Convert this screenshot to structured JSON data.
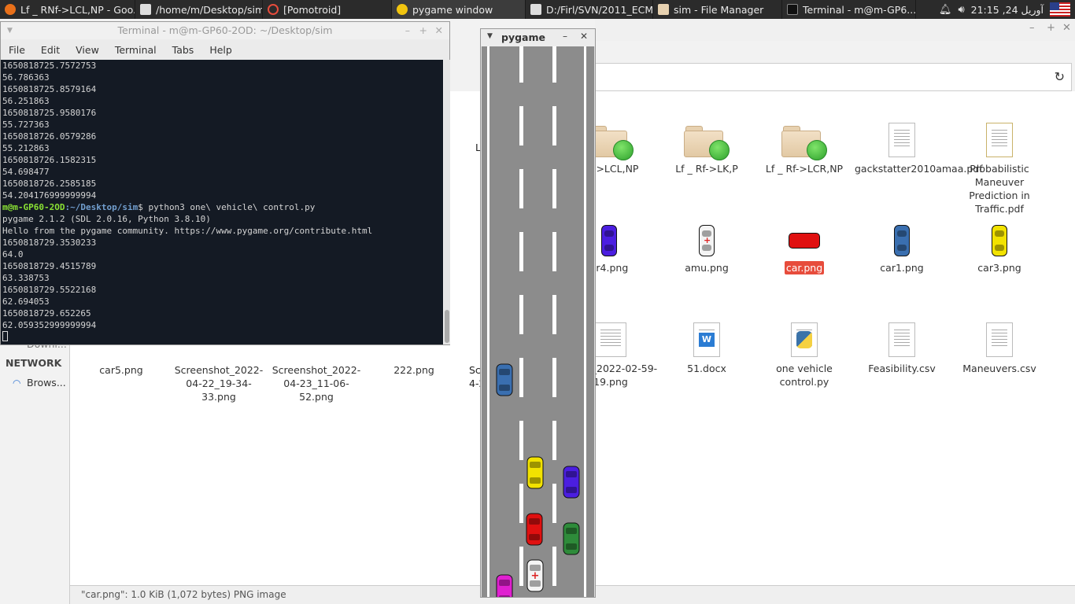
{
  "taskbar": {
    "tasks": [
      {
        "label": "Lf _ RNf->LCL,NP - Goo...",
        "icon": "firefox-icon",
        "color": "#e8701a",
        "active": false
      },
      {
        "label": "/home/m/Desktop/sim...",
        "icon": "text-editor-icon",
        "color": "#dddddd",
        "active": false
      },
      {
        "label": "[Pomotroid]",
        "icon": "pomotroid-icon",
        "color": "#e74c3c",
        "active": false
      },
      {
        "label": "pygame window",
        "icon": "pygame-icon",
        "color": "#f1c40f",
        "active": true
      },
      {
        "label": "D:/Firl/SVN/2011_ECM...",
        "icon": "document-viewer-icon",
        "color": "#dddddd",
        "active": false
      },
      {
        "label": "sim - File Manager",
        "icon": "folder-icon",
        "color": "#e7d1b0",
        "active": false
      },
      {
        "label": "Terminal - m@m-GP6...",
        "icon": "terminal-icon",
        "color": "#222222",
        "active": false
      }
    ],
    "clock": "21:15 ,24 آوریل",
    "bell_icon": "bell-icon",
    "volume_icon": "volume-icon",
    "flag_icon": "us-flag-icon"
  },
  "file_manager": {
    "status": "\"car.png\": 1.0 KiB (1,072 bytes) PNG image",
    "reload_icon": "reload-icon",
    "sidebar": {
      "partial_item": "Downl...",
      "network_heading": "NETWORK",
      "browse_item": "Brows..."
    },
    "partial_labels": {
      "row1_left": "L",
      "row3_sc": "Sc",
      "row3_sc2": "4-2"
    },
    "items": [
      {
        "id": "rf-lcl-np",
        "kind": "folder",
        "label": "Rf->LCL,NP"
      },
      {
        "id": "lk-p",
        "kind": "folder",
        "label": "Lf _ Rf->LK,P"
      },
      {
        "id": "lcr-np",
        "kind": "folder",
        "label": "Lf _ Rf->LCR,NP"
      },
      {
        "id": "gackstatter",
        "kind": "pdf",
        "label": "gackstatter2010amaa.pdf"
      },
      {
        "id": "probabilistic",
        "kind": "pdf",
        "label": "Probabilistic Maneuver Prediction in Traffic.pdf"
      },
      {
        "id": "car4",
        "kind": "car",
        "label": "ar4.png",
        "color": "#4b1ee0"
      },
      {
        "id": "amu",
        "kind": "ambulance",
        "label": "amu.png",
        "color": "#f4f4f4"
      },
      {
        "id": "car",
        "kind": "car-h",
        "label": "car.png",
        "color": "#e01010",
        "selected": true
      },
      {
        "id": "car1",
        "kind": "car",
        "label": "car1.png",
        "color": "#3a6fb0"
      },
      {
        "id": "car3",
        "kind": "car",
        "label": "car3.png",
        "color": "#f2e200"
      },
      {
        "id": "car5",
        "kind": "none",
        "label": "car5.png"
      },
      {
        "id": "ss1",
        "kind": "none",
        "label": "Screenshot_2022-04-22_19-34-33.png"
      },
      {
        "id": "ss2",
        "kind": "none",
        "label": "Screenshot_2022-04-23_11-06-52.png"
      },
      {
        "id": "n222",
        "kind": "none",
        "label": "222.png"
      },
      {
        "id": "ss3",
        "kind": "image",
        "label": "nshot_2022-02-59-19.png"
      },
      {
        "id": "docx51",
        "kind": "docx",
        "label": "51.docx"
      },
      {
        "id": "onevehicle",
        "kind": "python",
        "label": "one vehicle control.py"
      },
      {
        "id": "feas",
        "kind": "csv",
        "label": "Feasibility.csv"
      },
      {
        "id": "man",
        "kind": "csv",
        "label": "Maneuvers.csv"
      }
    ]
  },
  "terminal": {
    "title": "Terminal - m@m-GP60-2OD: ~/Desktop/sim",
    "menu": [
      "File",
      "Edit",
      "View",
      "Terminal",
      "Tabs",
      "Help"
    ],
    "lines_before": [
      "1650818725.7572753",
      "56.786363",
      "1650818725.8579164",
      "56.251863",
      "1650818725.9580176",
      "55.727363",
      "1650818726.0579286",
      "55.212863",
      "1650818726.1582315",
      "54.698477",
      "1650818726.2585185",
      "54.204176999999994"
    ],
    "prompt_user": "m@m-GP60-2OD",
    "prompt_path": ":~/Desktop/sim",
    "prompt_cmd": "$ python3 one\\ vehicle\\ control.py",
    "lines_after": [
      "pygame 2.1.2 (SDL 2.0.16, Python 3.8.10)",
      "Hello from the pygame community. https://www.pygame.org/contribute.html",
      "1650818729.3530233",
      "64.0",
      "1650818729.4515789",
      "63.338753",
      "1650818729.5522168",
      "62.694053",
      "1650818729.652265",
      "62.059352999999994"
    ]
  },
  "pygame": {
    "title": "pygame",
    "menu_icon": "window-menu-icon",
    "minimize_icon": "minimize-icon",
    "close_icon": "close-icon",
    "road_color": "#8c8c8c",
    "cars": [
      {
        "name": "blue-car",
        "color": "#3a6fb0",
        "kind": "car"
      },
      {
        "name": "yellow-car",
        "color": "#f2e200",
        "kind": "car"
      },
      {
        "name": "purple-car",
        "color": "#4b1ee0",
        "kind": "car"
      },
      {
        "name": "red-car",
        "color": "#e01010",
        "kind": "car"
      },
      {
        "name": "green-car",
        "color": "#2e8b3a",
        "kind": "car"
      },
      {
        "name": "ambulance",
        "color": "#f4f4f4",
        "kind": "ambulance"
      },
      {
        "name": "magenta-car",
        "color": "#e020d0",
        "kind": "car"
      }
    ]
  }
}
